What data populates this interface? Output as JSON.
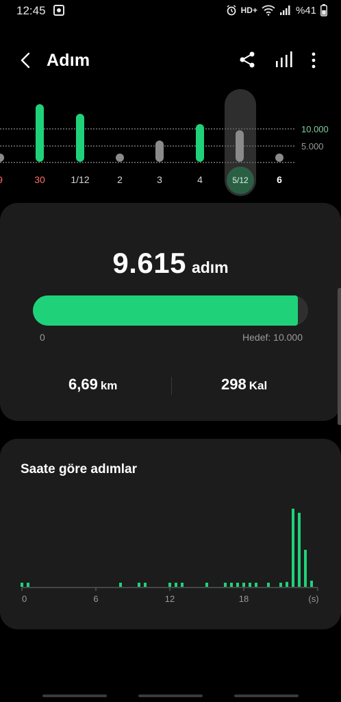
{
  "status_bar": {
    "time": "12:45",
    "hd_label": "HD+",
    "battery": "%41"
  },
  "header": {
    "title": "Adım",
    "icons": [
      "back-icon",
      "share-icon",
      "bar-chart-icon",
      "more-options-icon"
    ]
  },
  "day_chart": {
    "goal_label": "10.000",
    "half_label": "5.000",
    "days": [
      {
        "label": "9",
        "steps": 0,
        "met_goal": false,
        "color": "#ff6b6b"
      },
      {
        "label": "30",
        "steps": 15000,
        "met_goal": true,
        "color": "#ff6b6b"
      },
      {
        "label": "1/12",
        "steps": 12500,
        "met_goal": true,
        "color": "#d8d8d8"
      },
      {
        "label": "2",
        "steps": 1800,
        "met_goal": false,
        "color": "#d8d8d8"
      },
      {
        "label": "3",
        "steps": 5600,
        "met_goal": false,
        "color": "#d8d8d8"
      },
      {
        "label": "4",
        "steps": 9800,
        "met_goal": false,
        "color": "#d8d8d8"
      },
      {
        "label": "5/12",
        "steps": 9615,
        "met_goal": false,
        "selected": true,
        "color": "#d8f5e4"
      },
      {
        "label": "6",
        "steps": 0,
        "met_goal": false,
        "color": "#ffffff"
      }
    ]
  },
  "summary": {
    "steps": "9.615",
    "steps_unit": "adım",
    "progress_fraction": 0.9615,
    "min_label": "0",
    "goal_label": "Hedef: 10.000",
    "distance_value": "6,69",
    "distance_unit": "km",
    "calories_value": "298",
    "calories_unit": "Kal"
  },
  "hourly": {
    "title": "Saate göre adımlar",
    "x_labels": [
      "0",
      "6",
      "12",
      "18",
      "(s)"
    ],
    "colors": {
      "bar": "#1fd27a",
      "axis": "#555555"
    }
  },
  "chart_data": {
    "type": "bar",
    "title": "Saate göre adımlar",
    "xlabel": "(s)",
    "ylabel": "",
    "x_ticks": [
      "0",
      "6",
      "12",
      "18"
    ],
    "x": [
      0,
      0.5,
      8,
      9.5,
      10,
      12,
      12.5,
      13,
      15,
      16.5,
      17,
      17.5,
      18,
      18.5,
      19,
      20,
      21,
      21.5,
      22,
      22.5,
      23,
      23.5
    ],
    "values": [
      40,
      40,
      40,
      40,
      40,
      40,
      40,
      40,
      40,
      40,
      40,
      40,
      40,
      40,
      40,
      40,
      80,
      120,
      1900,
      1800,
      900,
      150
    ]
  },
  "colors": {
    "accent_green": "#1fd27a",
    "bar_gray": "#8a8a8a",
    "card_bg": "#1c1c1c",
    "goal_label_color": "#7fcf9f"
  }
}
